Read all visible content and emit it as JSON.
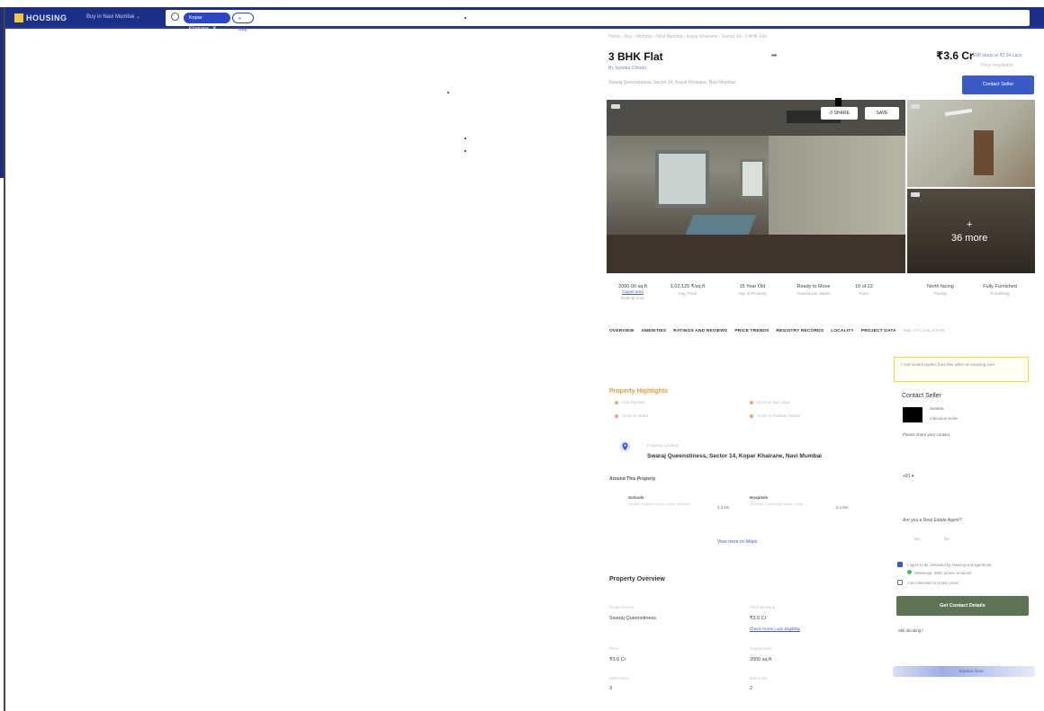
{
  "topbar": {
    "logo_text": "HOUSING",
    "city_selector": "Buy in Navi Mumbai ⌄",
    "search_chip": "Kopar Khairane",
    "search_chip_close": "✕",
    "more_chip": "+ Buy"
  },
  "listing": {
    "breadcrumb": "Home › Buy › Mumbai › Navi Mumbai › Kopar Khairane › Sector 14 › 3 BHK Flat",
    "title": "3 BHK Flat",
    "posted_by": "By Sumitra Chhetri",
    "address_line": "Swaraj Queenstiness, Sector 14, Kopar Khairane, Navi Mumbai",
    "price": "₹3.6 Cr",
    "emi_text": "EMI starts at ₹2.54 Lacs",
    "price_sub": "Price negotiable",
    "contact_button": "Contact Seller",
    "share_button": "SHARE",
    "save_button": "SAVE",
    "more_photos_plus": "+",
    "more_photos": "36 more"
  },
  "stats": [
    {
      "value": "2000.00 sq.ft",
      "label": "Built-up Area",
      "link": "Carpet area"
    },
    {
      "value": "1,02,125 ₹/sq.ft",
      "label": "Avg. Price"
    },
    {
      "value": "15 Year Old",
      "label": "Age of Property"
    },
    {
      "value": "Ready to Move",
      "label": "Possession Status"
    },
    {
      "value": "10 of 22",
      "label": "Floor"
    },
    {
      "value": "North facing",
      "label": "Facing"
    },
    {
      "value": "Fully Furnished",
      "label": "Furnishing"
    }
  ],
  "tabs": [
    "OVERVIEW",
    "AMENITIES",
    "RATINGS AND REVIEWS",
    "PRICE TRENDS",
    "REGISTRY RECORDS",
    "LOCALITY",
    "PROJECT DATA",
    "EMI CALCULATOR"
  ],
  "highlights": {
    "title": "Property Highlights",
    "items": [
      "Gas Pipeline",
      "Close to Metro",
      "Close to Bus Stop",
      "Close to Railway Station"
    ]
  },
  "location": {
    "label": "Property Location",
    "address": "Swaraj Queenstiness, Sector 14, Kopar Khairane, Navi Mumbai",
    "around_title": "Around This Property",
    "places": [
      {
        "type": "Schools",
        "name": "Nirmala Convent School, Kopar Khairane",
        "distance": "1.4 km"
      },
      {
        "type": "Hospitals",
        "name": "Kamothe Community Health Centre",
        "distance": "2.1 km"
      }
    ],
    "view_map": "View more on Maps"
  },
  "overview": {
    "title": "Property Overview",
    "fields": [
      {
        "label": "Project Name",
        "value": "Swaraj Queenstiness"
      },
      {
        "label": "Price Breakup",
        "value": "₹3.6 Cr",
        "link": "Check Home Loan Eligibility"
      },
      {
        "label": "Price",
        "value": "₹3.6 Cr"
      },
      {
        "label": "Carpet Area",
        "value": "2000 sq.ft"
      },
      {
        "label": "Bathrooms",
        "value": "3"
      },
      {
        "label": "Balconies",
        "value": "2"
      }
    ]
  },
  "contact": {
    "note": "Get instant replies from this seller on Housing.com",
    "title": "Contact Seller",
    "seller_name": "Sumitra",
    "seller_sub": "Individual Seller",
    "please_share": "Please share your contact",
    "phone_code": "+91 ▾",
    "agent_question": "Are you a Real Estate Agent?",
    "yes": "Yes",
    "no": "No",
    "consent_text": "I agree to be contacted by Housing and agents via",
    "whatsapp_text": "WhatsApp, SMS, phone, email etc",
    "interested_text": "I am interested in Home Loans",
    "get_contact_button": "Get Contact Details",
    "still_question": "Still deciding?",
    "bottom_link": "Explore more"
  }
}
